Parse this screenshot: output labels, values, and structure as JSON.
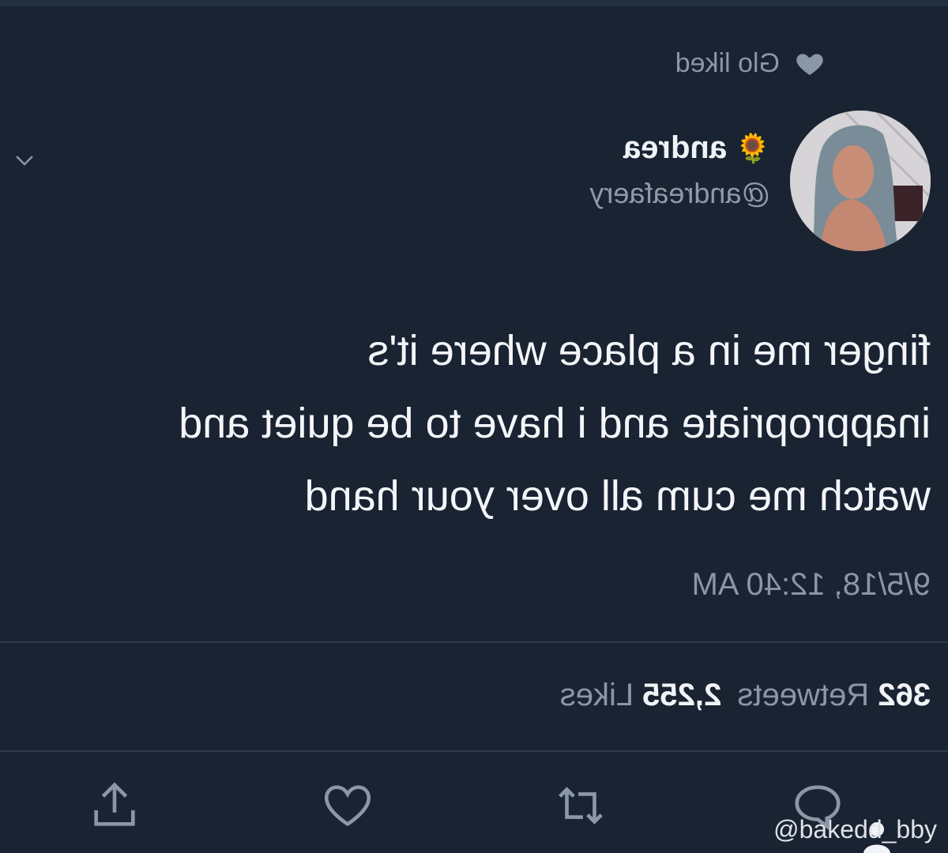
{
  "social_context": {
    "text": "Glo liked",
    "icon": "heart-icon"
  },
  "author": {
    "display_name": "andrea",
    "emoji": "🌻",
    "handle": "@andreafaery"
  },
  "tweet": {
    "lines": [
      "finger me in a place where it's",
      "inappropriate and i have to be quiet and",
      "watch me cum all over your hand"
    ],
    "timestamp": "9/5/18, 12:40 AM"
  },
  "stats": {
    "retweets_count": "362",
    "retweets_label": "Retweets",
    "likes_count": "2,255",
    "likes_label": "Likes"
  },
  "actions": {
    "reply_icon": "reply-icon",
    "retweet_icon": "retweet-icon",
    "like_icon": "heart-outline-icon",
    "share_icon": "share-icon"
  },
  "watermark": "@bakedd_bby",
  "colors": {
    "background": "#192332",
    "text_primary": "#f3f5f8",
    "text_secondary": "#8a97a6"
  }
}
